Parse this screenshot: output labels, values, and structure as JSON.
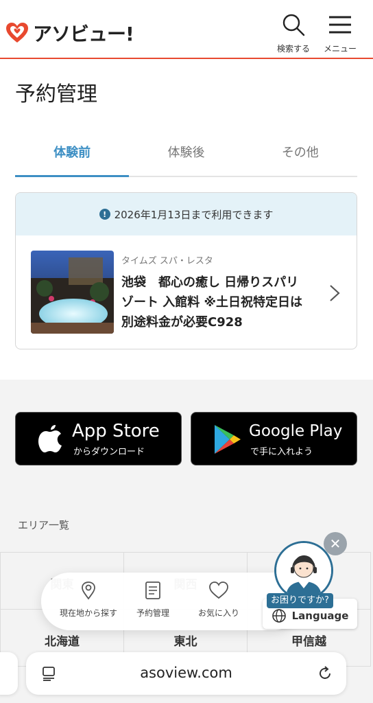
{
  "header": {
    "logo_text": "アソビュー!",
    "search_label": "検索する",
    "menu_label": "メニュー"
  },
  "page_title": "予約管理",
  "tabs": [
    {
      "label": "体験前",
      "active": true
    },
    {
      "label": "体験後",
      "active": false
    },
    {
      "label": "その他",
      "active": false
    }
  ],
  "reservation": {
    "notice": "2026年1月13日まで利用できます",
    "provider": "タイムズ スパ・レスタ",
    "title_lines": [
      "池袋　都心の癒し 日帰りスパリ",
      "ゾート 入館料 ※土日祝特定日は",
      "別途料金が必要C928"
    ]
  },
  "stores": {
    "appstore_main": "App Store",
    "appstore_sub": "からダウンロード",
    "googleplay_main": "Google Play",
    "googleplay_sub": "で手に入れよう"
  },
  "area": {
    "title": "エリア一覧",
    "cells": [
      "関東",
      "関西",
      "",
      "北海道",
      "東北",
      "甲信越"
    ]
  },
  "bottom_nav": [
    {
      "label": "現在地から探す",
      "icon": "location-pin-icon"
    },
    {
      "label": "予約管理",
      "icon": "document-icon"
    },
    {
      "label": "お気に入り",
      "icon": "heart-icon"
    }
  ],
  "help": {
    "badge": "お困りですか?",
    "language": "Language"
  },
  "browser": {
    "url": "asoview.com"
  },
  "colors": {
    "brand_red": "#e8492f",
    "accent_blue": "#3d8fc4",
    "notice_bg": "#e4f2f8"
  }
}
